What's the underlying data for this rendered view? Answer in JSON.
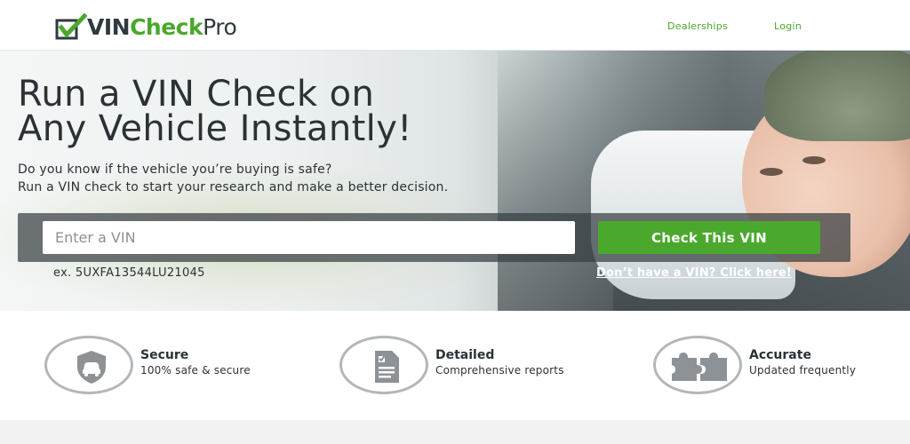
{
  "header": {
    "logo": {
      "vin": "VIN",
      "check": "Check",
      "pro": "Pro"
    },
    "nav": [
      {
        "label": "Dealerships"
      },
      {
        "label": "Login"
      }
    ]
  },
  "hero": {
    "title_line1": "Run a VIN Check on",
    "title_line2": "Any Vehicle Instantly!",
    "subtitle_line1": "Do you know if the vehicle you’re buying is safe?",
    "subtitle_line2": "Run a VIN check to start your research and make a better decision.",
    "vin_input": {
      "placeholder": "Enter a VIN",
      "value": ""
    },
    "check_button": "Check This VIN",
    "example": "ex. 5UXFA13544LU21045",
    "no_vin_link": "Don’t have a VIN? Click here!"
  },
  "features": [
    {
      "icon": "secure-car-shield-icon",
      "title": "Secure",
      "desc": "100% safe & secure"
    },
    {
      "icon": "report-document-icon",
      "title": "Detailed",
      "desc": "Comprehensive reports"
    },
    {
      "icon": "puzzle-piece-icon",
      "title": "Accurate",
      "desc": "Updated frequently"
    }
  ],
  "colors": {
    "brand_green": "#4aa82d",
    "dark_text": "#2b3236",
    "icon_gray": "#b3b7ba"
  }
}
